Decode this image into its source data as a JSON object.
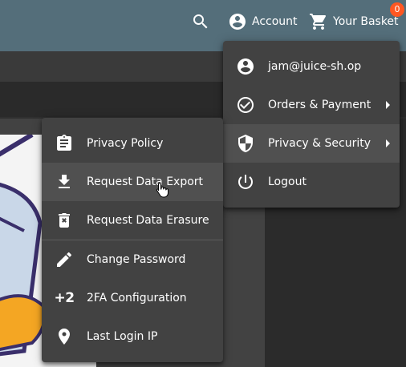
{
  "colors": {
    "toolbar": "#546e7a",
    "menu_bg": "#424242",
    "highlight": "#505050",
    "badge": "#ff5722",
    "page_bg": "#303030"
  },
  "toolbar": {
    "search_icon": "search-icon",
    "account_label": "Account",
    "basket_label": "Your Basket",
    "basket_count": "0"
  },
  "account_menu": {
    "items": [
      {
        "label": "jam@juice-sh.op",
        "icon": "account-circle-icon"
      },
      {
        "label": "Orders & Payment",
        "icon": "check-circle-icon",
        "submenu": true
      },
      {
        "label": "Privacy & Security",
        "icon": "shield-icon",
        "submenu": true,
        "active": true
      },
      {
        "label": "Logout",
        "icon": "power-icon"
      }
    ]
  },
  "privacy_menu": {
    "items": [
      {
        "label": "Privacy Policy",
        "icon": "clipboard-icon"
      },
      {
        "label": "Request Data Export",
        "icon": "download-icon",
        "hovered": true
      },
      {
        "label": "Request Data Erasure",
        "icon": "delete-icon"
      },
      {
        "label": "Change Password",
        "icon": "pencil-icon"
      },
      {
        "label": "2FA Configuration",
        "icon": "plus-two-icon",
        "icon_text": "+2"
      },
      {
        "label": "Last Login IP",
        "icon": "location-pin-icon"
      }
    ]
  }
}
